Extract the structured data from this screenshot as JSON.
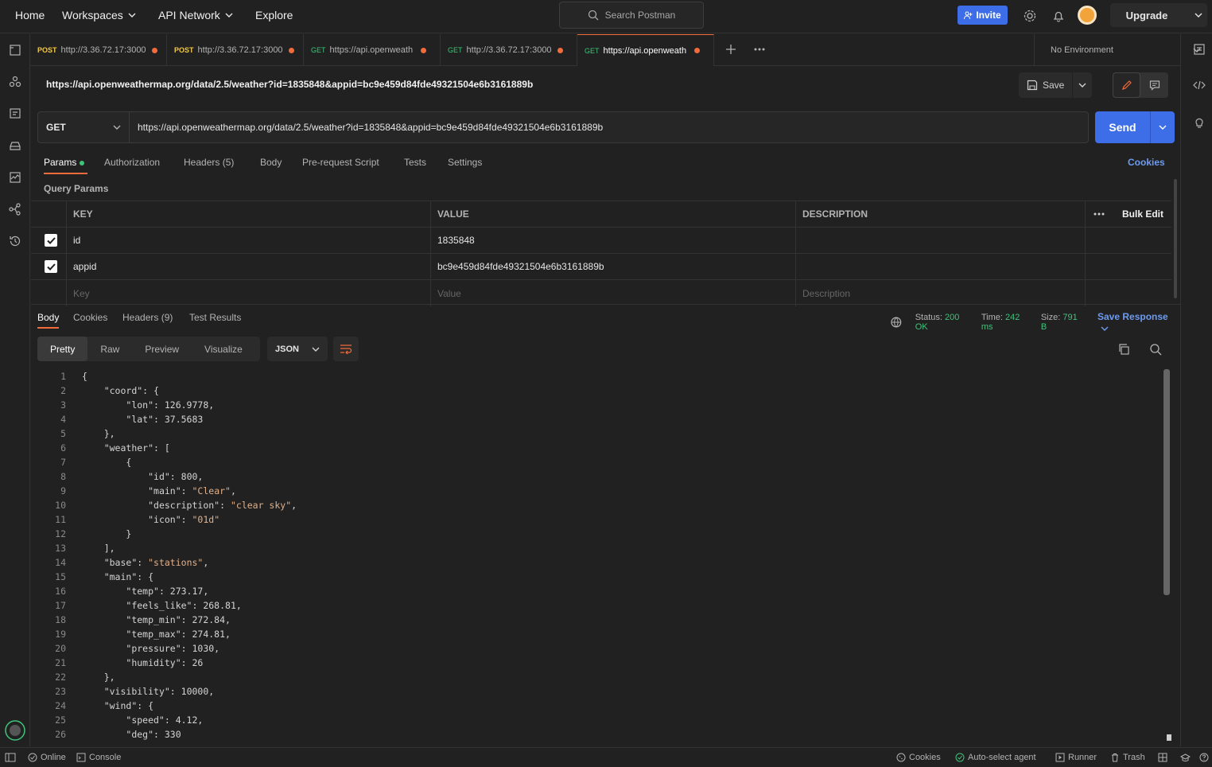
{
  "nav": {
    "home": "Home",
    "workspaces": "Workspaces",
    "api_network": "API Network",
    "explore": "Explore",
    "search_placeholder": "Search Postman",
    "invite": "Invite",
    "upgrade": "Upgrade"
  },
  "tabs": [
    {
      "method": "POST",
      "url": "http://3.36.72.17:3000",
      "method_color": "#f2c94c"
    },
    {
      "method": "POST",
      "url": "http://3.36.72.17:3000",
      "method_color": "#f2c94c"
    },
    {
      "method": "GET",
      "url": "https://api.openweath",
      "method_color": "#3fc37a"
    },
    {
      "method": "GET",
      "url": "http://3.36.72.17:3000",
      "method_color": "#3fc37a"
    },
    {
      "method": "GET",
      "url": "https://api.openweath",
      "method_color": "#3fc37a"
    }
  ],
  "environment": "No Environment",
  "request": {
    "title": "https://api.openweathermap.org/data/2.5/weather?id=1835848&appid=bc9e459d84fde49321504e6b3161889b",
    "save": "Save",
    "method": "GET",
    "url": "https://api.openweathermap.org/data/2.5/weather?id=1835848&appid=bc9e459d84fde49321504e6b3161889b",
    "send": "Send",
    "tabs": [
      "Params",
      "Authorization",
      "Headers (5)",
      "Body",
      "Pre-request Script",
      "Tests",
      "Settings"
    ],
    "cookies": "Cookies",
    "query_params_label": "Query Params",
    "headers": {
      "key": "KEY",
      "value": "VALUE",
      "description": "DESCRIPTION",
      "bulk_edit": "Bulk Edit"
    },
    "params": [
      {
        "key": "id",
        "value": "1835848",
        "description": ""
      },
      {
        "key": "appid",
        "value": "bc9e459d84fde49321504e6b3161889b",
        "description": ""
      }
    ],
    "placeholders": {
      "key": "Key",
      "value": "Value",
      "description": "Description"
    }
  },
  "response": {
    "tabs": [
      "Body",
      "Cookies",
      "Headers (9)",
      "Test Results"
    ],
    "status_label": "Status:",
    "status": "200 OK",
    "time_label": "Time:",
    "time": "242 ms",
    "size_label": "Size:",
    "size": "791 B",
    "save_response": "Save Response",
    "views": [
      "Pretty",
      "Raw",
      "Preview",
      "Visualize"
    ],
    "format": "JSON",
    "lines": [
      "{",
      "    \"coord\": {",
      "        \"lon\": 126.9778,",
      "        \"lat\": 37.5683",
      "    },",
      "    \"weather\": [",
      "        {",
      "            \"id\": 800,",
      "            \"main\": \"Clear\",",
      "            \"description\": \"clear sky\",",
      "            \"icon\": \"01d\"",
      "        }",
      "    ],",
      "    \"base\": \"stations\",",
      "    \"main\": {",
      "        \"temp\": 273.17,",
      "        \"feels_like\": 268.81,",
      "        \"temp_min\": 272.84,",
      "        \"temp_max\": 274.81,",
      "        \"pressure\": 1030,",
      "        \"humidity\": 26",
      "    },",
      "    \"visibility\": 10000,",
      "    \"wind\": {",
      "        \"speed\": 4.12,",
      "        \"deg\": 330"
    ]
  },
  "statusbar": {
    "online": "Online",
    "console": "Console",
    "cookies": "Cookies",
    "auto_select_agent": "Auto-select agent",
    "runner": "Runner",
    "trash": "Trash"
  },
  "colors": {
    "accent": "#3d6ee8",
    "orange": "#f26b3a",
    "green": "#3fc37a",
    "link": "#6c9bf0"
  }
}
